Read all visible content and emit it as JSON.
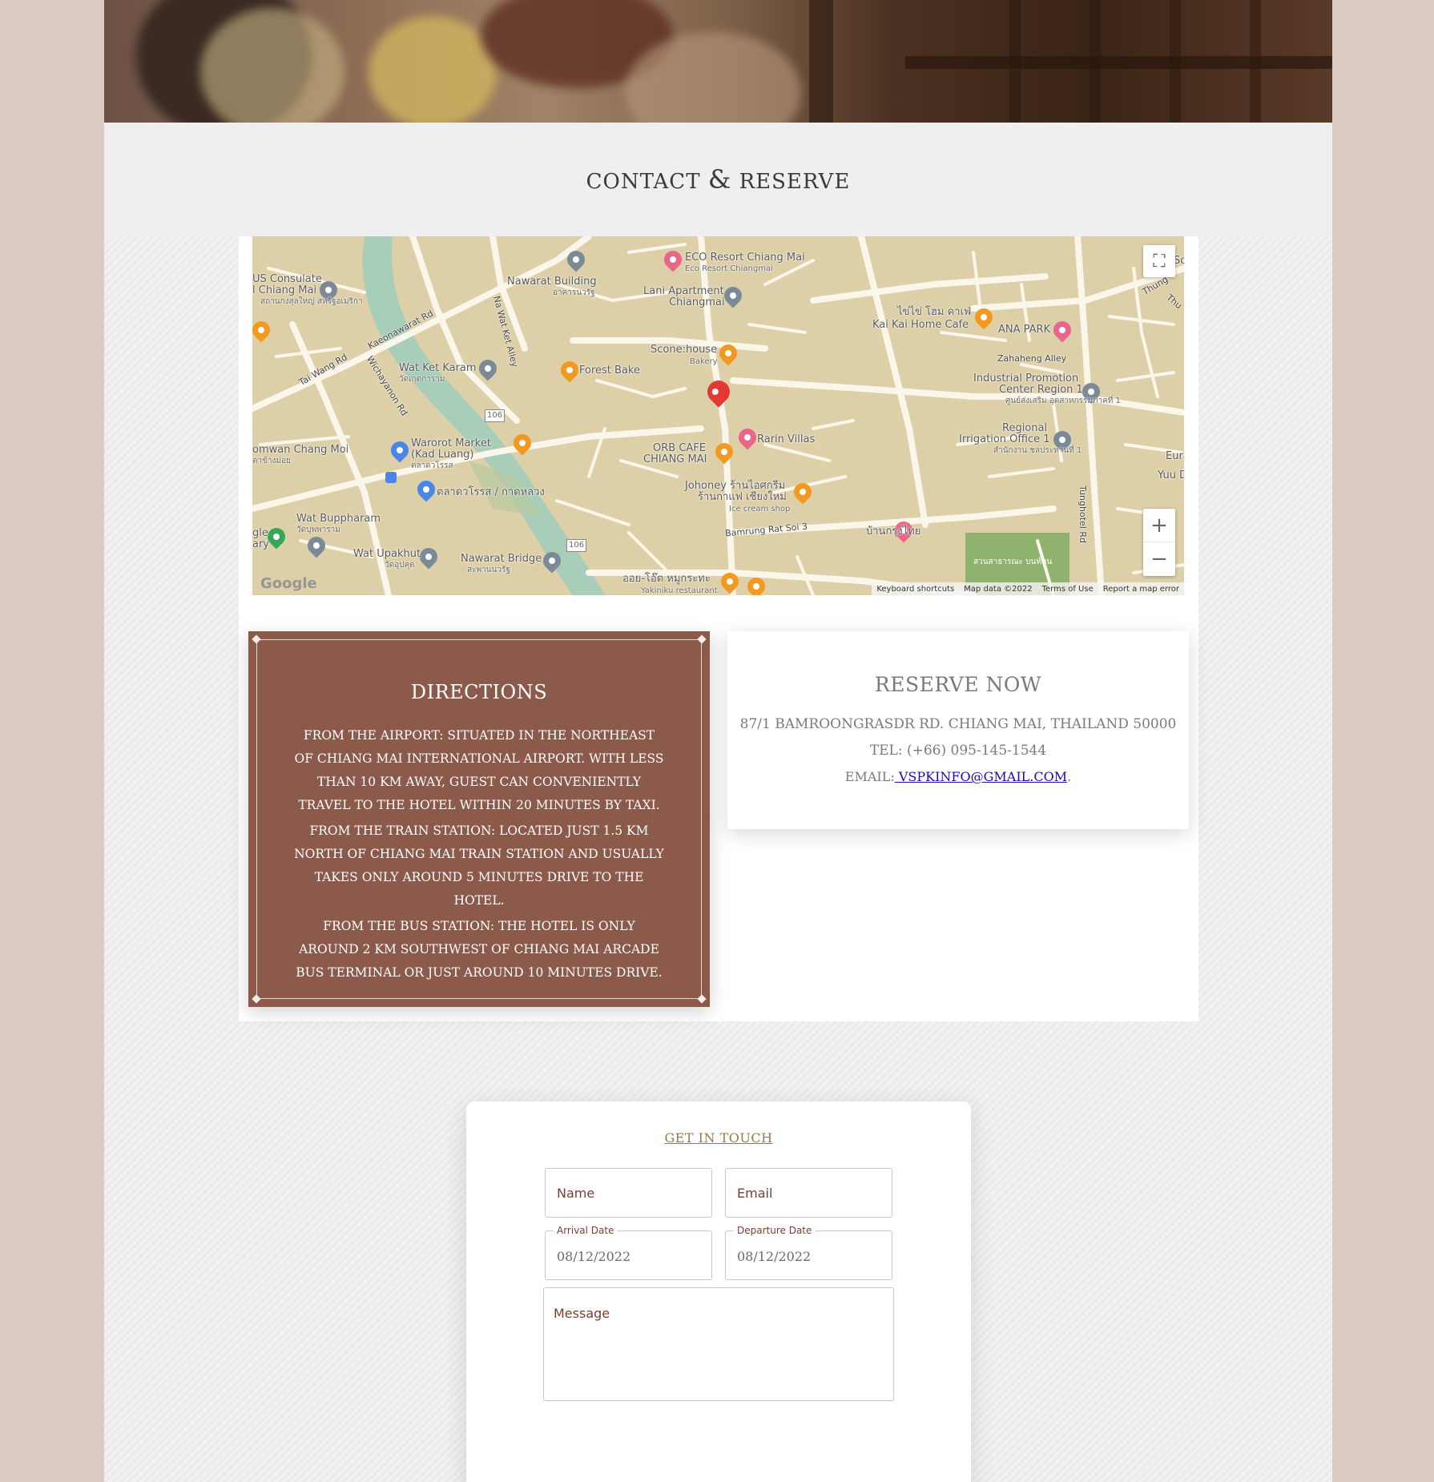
{
  "section": {
    "title_part1": "CONTACT",
    "title_amp": "&",
    "title_part2": "RESERVE"
  },
  "map": {
    "labels": {
      "us_consulate": "US Consulate",
      "chiang_mai_consulate": "l Chiang Mai",
      "consulate_thai": "สถานกงสุลใหญ่ สหรัฐอเมริกา",
      "nawarat_building": "Nawarat Building",
      "nawarat_building_thai": "อาคารนวรัฐ",
      "eco_resort": "ECO Resort Chiang Mai",
      "eco_resort_sub": "Eco Resort Chiangmai",
      "lani": "Lani Apartment",
      "lani2": "Chiangmai",
      "kaikai_thai": "ไข่ไข่ โฮม คาเฟ่",
      "kaikai": "Kai Kai Home Cafe",
      "ana_park": "ANA PARK",
      "keonawarat": "Kaeonawarat Rd",
      "na_wat_ket": "Na Wat Ket Alley",
      "tai_wang": "Tai Wang Rd",
      "wichayanon": "Wichayanon Rd",
      "wat_ket": "Wat Ket Karam",
      "wat_ket_thai": "วัดเกตการาม",
      "forest_bake": "Forest Bake",
      "scone": "Scone:house",
      "scone_sub": "Bakery",
      "zahaheng": "Zahaheng Alley",
      "industrial": "Industrial Promotion",
      "industrial2": "Center Region 1",
      "industrial_thai": "ศูนย์ส่งเสริม อุตสาหกรรมภาคที่ 1",
      "r106a": "106",
      "rarin": "Rarin Villas",
      "regional": "Regional",
      "irrigation": "Irrigation Office 1",
      "irrigation_thai": "สำนักงาน ชลประทานที่ 1",
      "orb1": "ORB CAFE",
      "orb2": "CHIANG MAI",
      "warorot": "Warorot Market",
      "kad_luang": "(Kad Luang)",
      "kad_luang_thai": "ตลาดวโรรส",
      "omwan": "omwan Chang Moi",
      "omwan_thai": "ตาข้างม่อย",
      "eura": "Eura",
      "yuu": "Yuu D",
      "thung": "Thung",
      "thu": "Thu",
      "johoney1": "Johoney ร้านไอศกรีม",
      "johoney2": "ร้านกาแฟ เชียงใหม่",
      "johoney_sub": "Ice cream shop",
      "tunghotel": "Tunghotel Rd",
      "market_thai": "ตลาดวโรรส / กาดหลวง",
      "wat_bupp": "Wat Buppharam",
      "wat_bupp_thai": "วัดบุพพาราม",
      "bamrung": "Bamrung Rat Soi 3",
      "baan": "บ้านกรุงไทย",
      "park_thai": "สวนสาธารณะ บนท์ดน",
      "gle": "gle",
      "ary": "ary",
      "wat_upakhut": "Wat Upakhut",
      "wat_upakhut_thai": "วัดอุปคุต",
      "r106b": "106",
      "nawarat_bridge": "Nawarat Bridge",
      "nawarat_bridge_thai": "สะพานนวรัฐ",
      "yakiniku_thai": "ออย-โอ๊ต หมูกระทะ",
      "yakiniku": "Yakiniku restaurant",
      "so": "So"
    },
    "zoom_in": "+",
    "zoom_out": "−",
    "fullscreen_icon": "⛶",
    "google": "Google",
    "attrib_shortcuts": "Keyboard shortcuts",
    "attrib_data": "Map data ©2022",
    "attrib_terms": "Terms of Use",
    "attrib_report": "Report a map error"
  },
  "directions": {
    "title": "DIRECTIONS",
    "airport": "From the airport: Situated in the northeast of Chiang Mai International Airport. With less than 10 km away, guest can conveniently travel to the hotel within 20 minutes by taxi.",
    "train": "From the train station: Located just 1.5 km north of Chiang Mai train station and usually takes only around 5 minutes drive to the hotel.",
    "bus": "From the bus station: The hotel is only around 2 km southwest of Chiang Mai Arcade Bus Terminal or just around 10 minutes drive."
  },
  "reserve": {
    "title": "RESERVE NOW",
    "address": "87/1 BAMROONGRASDR RD. CHIANG MAI, THAILAND 50000",
    "tel": "TEL: (+66) 095-145-1544",
    "email_label": "EMAIL:",
    "email": " VSPKINFO@GMAIL.COM",
    "email_suffix": "."
  },
  "form": {
    "title": "GET IN TOUCH",
    "name_placeholder": "Name",
    "email_placeholder": "Email",
    "arrival_label": "Arrival Date",
    "arrival_value": "08/12/2022",
    "departure_label": "Departure Date",
    "departure_value": "08/12/2022",
    "message_placeholder": "Message"
  },
  "colors": {
    "directions_bg": "#8b5a4a",
    "page_bg": "#dccac4",
    "accent_gold": "#9a7a3a",
    "map_bg": "#ddd0a8",
    "river": "#a8cdb8"
  }
}
